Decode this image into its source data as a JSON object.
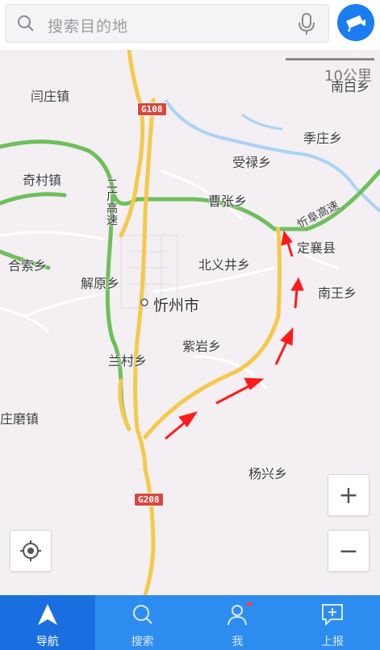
{
  "search": {
    "placeholder": "搜索目的地",
    "icon": "search-icon",
    "mic_icon": "mic-icon"
  },
  "camera": {
    "icon": "camera-icon",
    "color": "#1a7df0"
  },
  "map": {
    "scale_text": "10公里",
    "road_shields": [
      "G108",
      "G208"
    ],
    "highway_vertical": "二广高速",
    "highway_label": "忻阜高速",
    "city": "忻州市",
    "places": [
      "闫庄镇",
      "南白乡",
      "季庄乡",
      "受禄乡",
      "奇村镇",
      "曹张乡",
      "定襄县",
      "合索乡",
      "北义井乡",
      "解原乡",
      "南王乡",
      "紫岩乡",
      "兰村乡",
      "庄磨镇",
      "杨兴乡"
    ],
    "controls": {
      "zoom_in": "+",
      "zoom_out": "−",
      "locate_icon": "locate-icon"
    },
    "arrow_color": "#ff1a1a"
  },
  "nav": {
    "items": [
      {
        "label": "导航",
        "icon": "navigate-arrow-icon",
        "active": true
      },
      {
        "label": "搜索",
        "icon": "search-icon",
        "active": false
      },
      {
        "label": "我",
        "icon": "user-icon",
        "active": false
      },
      {
        "label": "上报",
        "icon": "report-icon",
        "active": false
      }
    ],
    "bg_color": "#2d8cf0"
  }
}
